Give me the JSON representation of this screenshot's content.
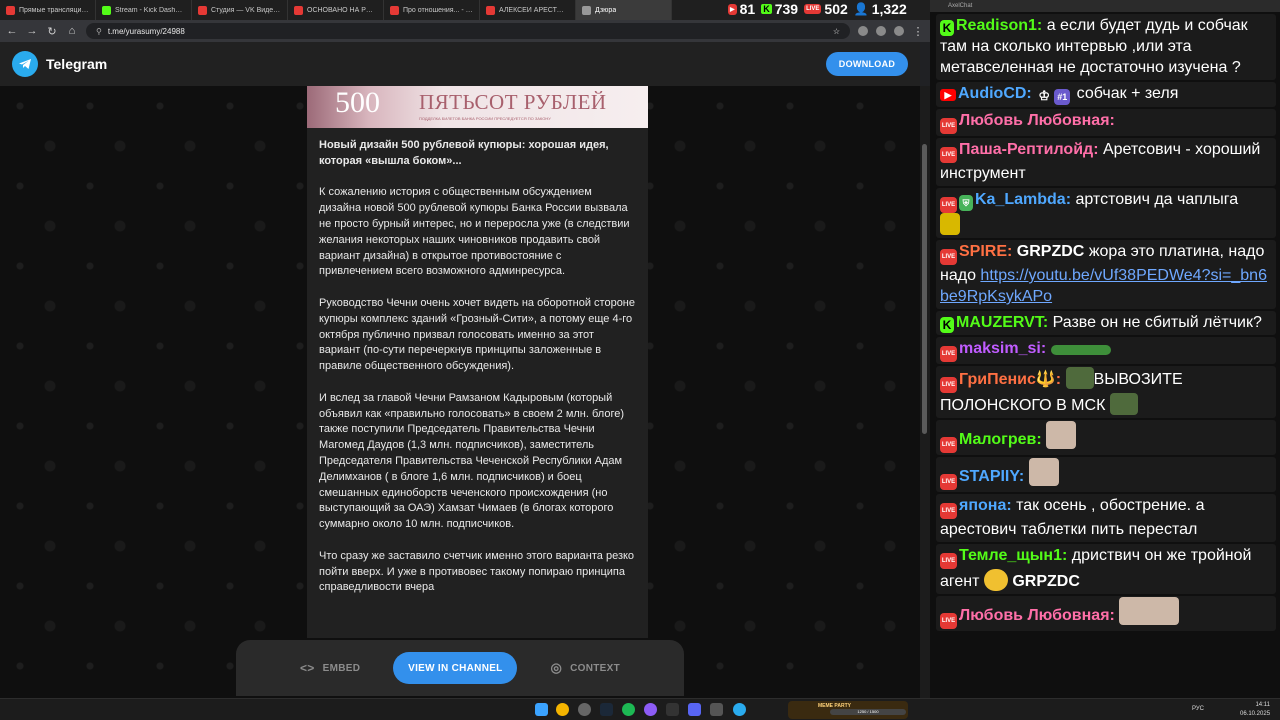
{
  "browser": {
    "tabs": [
      {
        "title": "Прямые трансляции - ",
        "color": "#e53935"
      },
      {
        "title": "Stream - Kick Dashboar",
        "color": "#53fc18"
      },
      {
        "title": "Студия — VK Видео Live",
        "color": "#e53935"
      },
      {
        "title": "ОСНОВАНО НА РЕАЛЬ...",
        "color": "#e53935"
      },
      {
        "title": "Про отношения... - You",
        "color": "#e53935"
      },
      {
        "title": "АЛЕКСЕЙ АРЕСТОВИЧ",
        "color": "#e53935"
      },
      {
        "title": "Дзюра",
        "color": "#999999"
      }
    ],
    "url": "t.me/yurasumy/24988",
    "stats": {
      "youtube": "81",
      "kick": "739",
      "vk": "502",
      "total": "1,322"
    }
  },
  "telegram": {
    "brand": "Telegram",
    "download_label": "DOWNLOAD",
    "banknote": {
      "number": "500",
      "words": "ПЯТЬСОТ РУБЛЕЙ",
      "subtext": "ПОДДЕЛКА БИЛЕТОВ БАНКА РОССИИ ПРЕСЛЕДУЕТСЯ ПО ЗАКОНУ"
    },
    "post": {
      "title": "Новый дизайн 500 рублевой купюры: хорошая идея, которая «вышла боком»...",
      "paragraphs": [
        "К сожалению история с общественным обсуждением дизайна новой 500 рублевой купюры Банка России вызвала не просто бурный интерес, но и переросла уже (в следствии желания некоторых наших чиновников продавить свой вариант дизайна) в открытое противостояние с привлечением всего возможного админресурса.",
        "Руководство Чечни очень хочет видеть на оборотной стороне купюры комплекс зданий «Грозный-Сити», а потому еще 4-го октября публично призвал голосовать именно за этот вариант (по-сути перечеркнув принципы заложенные в правиле общественного обсуждения).",
        "И вслед за главой Чечни Рамзаном Кадыровым (который объявил как «правильно голосовать» в своем 2 млн. блоге) также поступили Председатель Правительства Чечни Магомед Даудов (1,3 млн. подписчиков), заместитель Председателя Правительства Чеченской Республики Адам Делимханов ( в блоге 1,6 млн. подписчиков) и боец смешанных единоборств чеченского происхождения (но выступающий за ОАЭ) Хамзат Чимаев (в блогах которого суммарно около 10 млн. подписчиков.",
        "Что сразу же заставило счетчик именно этого варианта резко пойти вверх. И уже в противовес такому попираю принципа справедливости вчера"
      ]
    },
    "actions": {
      "embed": "EMBED",
      "view": "VIEW IN CHANNEL",
      "context": "CONTEXT"
    }
  },
  "chat": {
    "app_label": "AxelChat",
    "messages": [
      {
        "badge": "kick",
        "user": "Readison1:",
        "user_color": "#53fc18",
        "text": "а если будет дудь и собчак там на сколько интервью ,или эта метавселенная не достаточно изучена ?"
      },
      {
        "badge": "yt",
        "user": "AudioCD:",
        "user_color": "#4fa8ff",
        "sub": "#1",
        "text": "собчак + зеля"
      },
      {
        "badge": "live",
        "user": "Любовь Любовная:",
        "user_color": "#ff6fa8",
        "text": ""
      },
      {
        "badge": "live",
        "user": "Паша-Рептилойд:",
        "user_color": "#ff6fa8",
        "text": "Аретсович - хороший инструмент"
      },
      {
        "badge": "live",
        "user": "Ka_Lambda:",
        "user_color": "#4fa8ff",
        "text": "артстович да чаплыга"
      },
      {
        "badge": "live",
        "user": "SPIRE:",
        "user_color": "#ff7043",
        "bold": "GRPZDC",
        "text": "жора это платина, надо надо",
        "link": "https://youtu.be/vUf38PEDWe4?si=_bn6be9RpKsykAPo"
      },
      {
        "badge": "kick",
        "user": "MAUZERVT:",
        "user_color": "#53fc18",
        "text": "Разве он не сбитый лётчик?"
      },
      {
        "badge": "live",
        "user": "maksim_si:",
        "user_color": "#c05cff",
        "text": ""
      },
      {
        "badge": "live",
        "user": "ГриПенис🔱:",
        "user_color": "#ff7043",
        "text": "ВЫВОЗИТЕ ПОЛОНСКОГО В МСК"
      },
      {
        "badge": "live",
        "user": "Малогрев:",
        "user_color": "#53fc18",
        "text": ""
      },
      {
        "badge": "live",
        "user": "STAPIIY:",
        "user_color": "#4fa8ff",
        "text": ""
      },
      {
        "badge": "live",
        "user": "япона:",
        "user_color": "#4fa8ff",
        "text": "так осень , обострение. а арестович таблетки пить перестал"
      },
      {
        "badge": "live",
        "user": "Темле_щын1:",
        "user_color": "#53fc18",
        "text": "дриствич он же тройной агент",
        "bold": "GRPZDC"
      },
      {
        "badge": "live",
        "user": "Любовь Любовная:",
        "user_color": "#ff6fa8",
        "text": ""
      }
    ]
  },
  "taskbar": {
    "meme_label": "MEME PARTY",
    "meme_progress": "1250 / 1500",
    "lang": "РУС",
    "time": "14:11",
    "date": "06.10.2025"
  }
}
